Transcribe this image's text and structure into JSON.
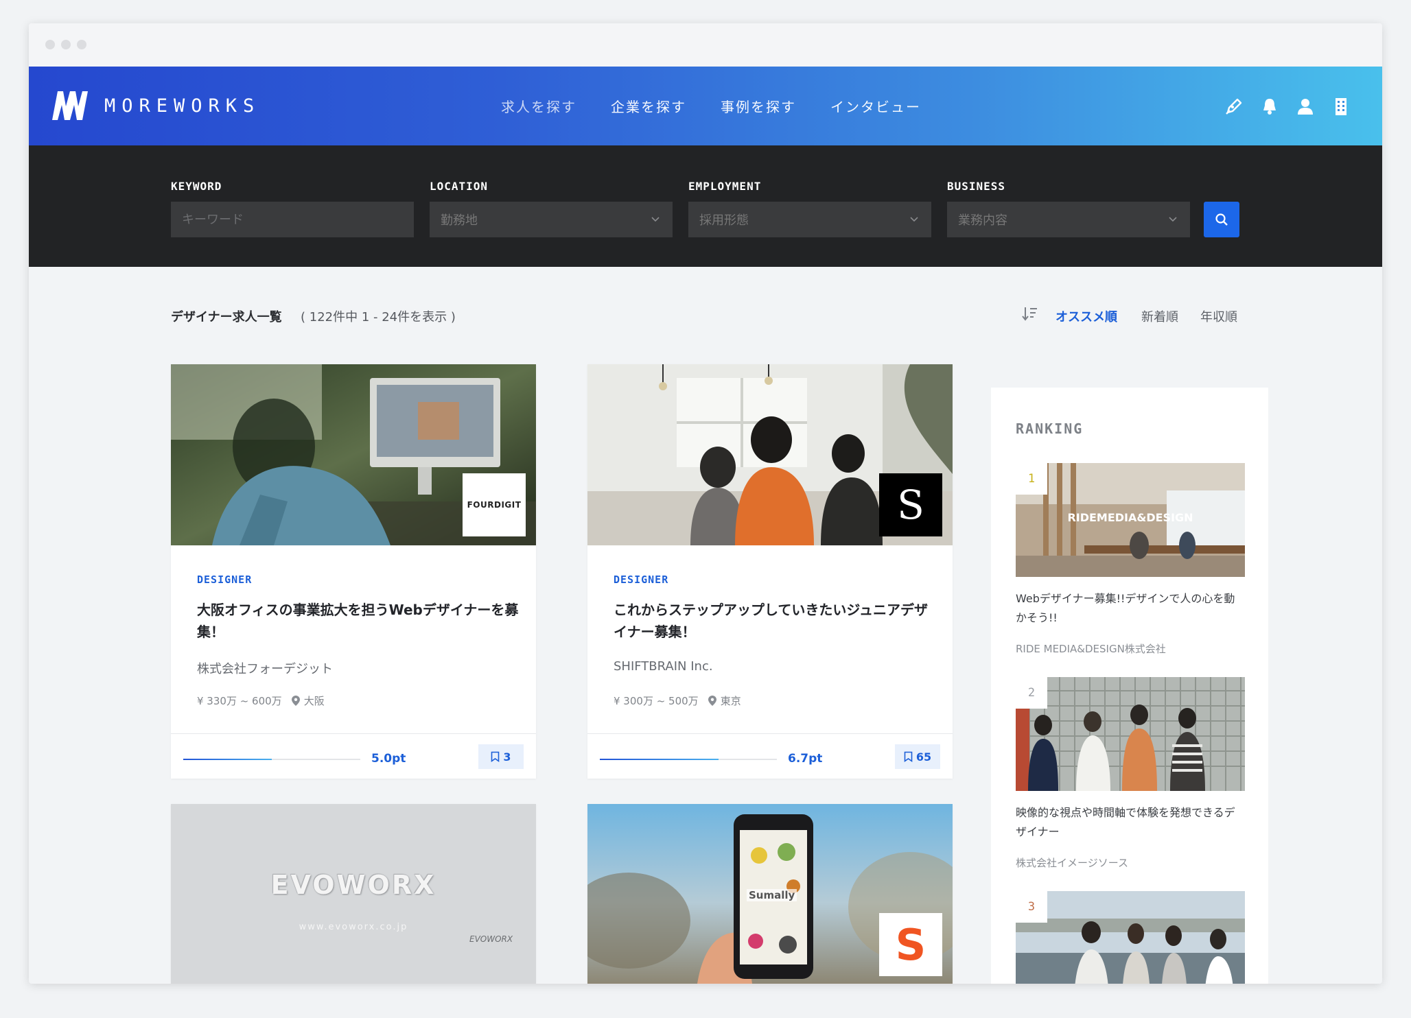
{
  "brand": {
    "name": "MOREWORKS"
  },
  "nav": {
    "items": [
      {
        "label": "求人を探す"
      },
      {
        "label": "企業を探す"
      },
      {
        "label": "事例を探す"
      },
      {
        "label": "インタビュー"
      }
    ]
  },
  "search": {
    "keyword_label": "KEYWORD",
    "keyword_placeholder": "キーワード",
    "location_label": "LOCATION",
    "location_value": "勤務地",
    "employment_label": "EMPLOYMENT",
    "employment_value": "採用形態",
    "business_label": "BUSINESS",
    "business_value": "業務内容"
  },
  "listing": {
    "title": "デザイナー求人一覧",
    "count": "( 122件中 1 - 24件を表示 )",
    "sort_options": [
      "オススメ順",
      "新着順",
      "年収順"
    ]
  },
  "jobs": [
    {
      "tag": "DESIGNER",
      "title": "大阪オフィスの事業拡大を担うWebデザイナーを募集！",
      "company": "株式会社フォーデジット",
      "salary": "¥ 330万 ~ 600万",
      "location": "大阪",
      "score": 0.5,
      "points": "5.0pt",
      "favorites": "3",
      "logo_text": "FOURDIGIT"
    },
    {
      "tag": "DESIGNER",
      "title": "これからステップアップしていきたいジュニアデザイナー募集！",
      "company": "SHIFTBRAIN Inc.",
      "salary": "¥ 300万 ~ 500万",
      "location": "東京",
      "score": 0.67,
      "points": "6.7pt",
      "favorites": "65",
      "logo_text": "S"
    },
    {
      "image_text": "EVOWORX",
      "image_url_text": "www.evoworx.co.jp",
      "image_small_text": "EVOWORX"
    },
    {
      "image_text": "Sumally",
      "logo_text": "S"
    }
  ],
  "ranking": {
    "heading": "RANKING",
    "items": [
      {
        "rank": "1",
        "title": "Webデザイナー募集!!デザインで人の心を動かそう!!",
        "company": "RIDE MEDIA&DESIGN株式会社",
        "image_text": "RIDEMEDIA&DESIGN",
        "rank_color": "#c7b21a"
      },
      {
        "rank": "2",
        "title": "映像的な視点や時間軸で体験を発想できるデザイナー",
        "company": "株式会社イメージソース",
        "rank_color": "#9a9ea4"
      },
      {
        "rank": "3",
        "rank_color": "#c0704a"
      }
    ]
  },
  "colors": {
    "accent": "#1c5fd8",
    "header_start": "#2548cf",
    "header_end": "#49c0ec",
    "searchbar": "#222325"
  }
}
